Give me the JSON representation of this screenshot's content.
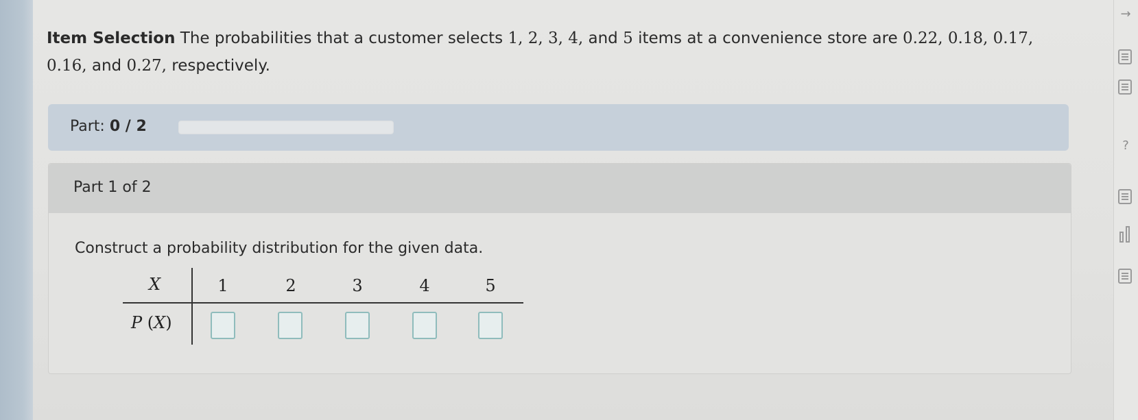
{
  "problem": {
    "title": "Item Selection",
    "text_1": "The probabilities that a customer selects",
    "items": "1, 2, 3, 4,",
    "text_2": "and",
    "last_item": "5",
    "text_3": "items at a convenience store are",
    "probs_1": "0.22, 0.18, 0.17,",
    "probs_2": "0.16,",
    "text_4": "and",
    "last_prob": "0.27,",
    "text_5": "respectively."
  },
  "progress": {
    "label": "Part:",
    "value": "0 / 2",
    "fraction": 0
  },
  "section": {
    "title": "Part 1 of 2",
    "instruction": "Construct a probability distribution for the given data."
  },
  "distribution": {
    "x_header": "X",
    "px_header_p": "P",
    "px_header_paren_open": "(",
    "px_header_x": "X",
    "px_header_paren_close": ")",
    "x_values": [
      "1",
      "2",
      "3",
      "4",
      "5"
    ],
    "answers": [
      "",
      "",
      "",
      "",
      ""
    ]
  },
  "tools": [
    "chevron-icon",
    "document-icon",
    "calculator-icon",
    "help-icon",
    "notes-icon",
    "bar-chart-icon",
    "list-icon"
  ],
  "colors": {
    "part_bar": "#c6d0da",
    "answer_box_border": "#8fbcbc"
  }
}
